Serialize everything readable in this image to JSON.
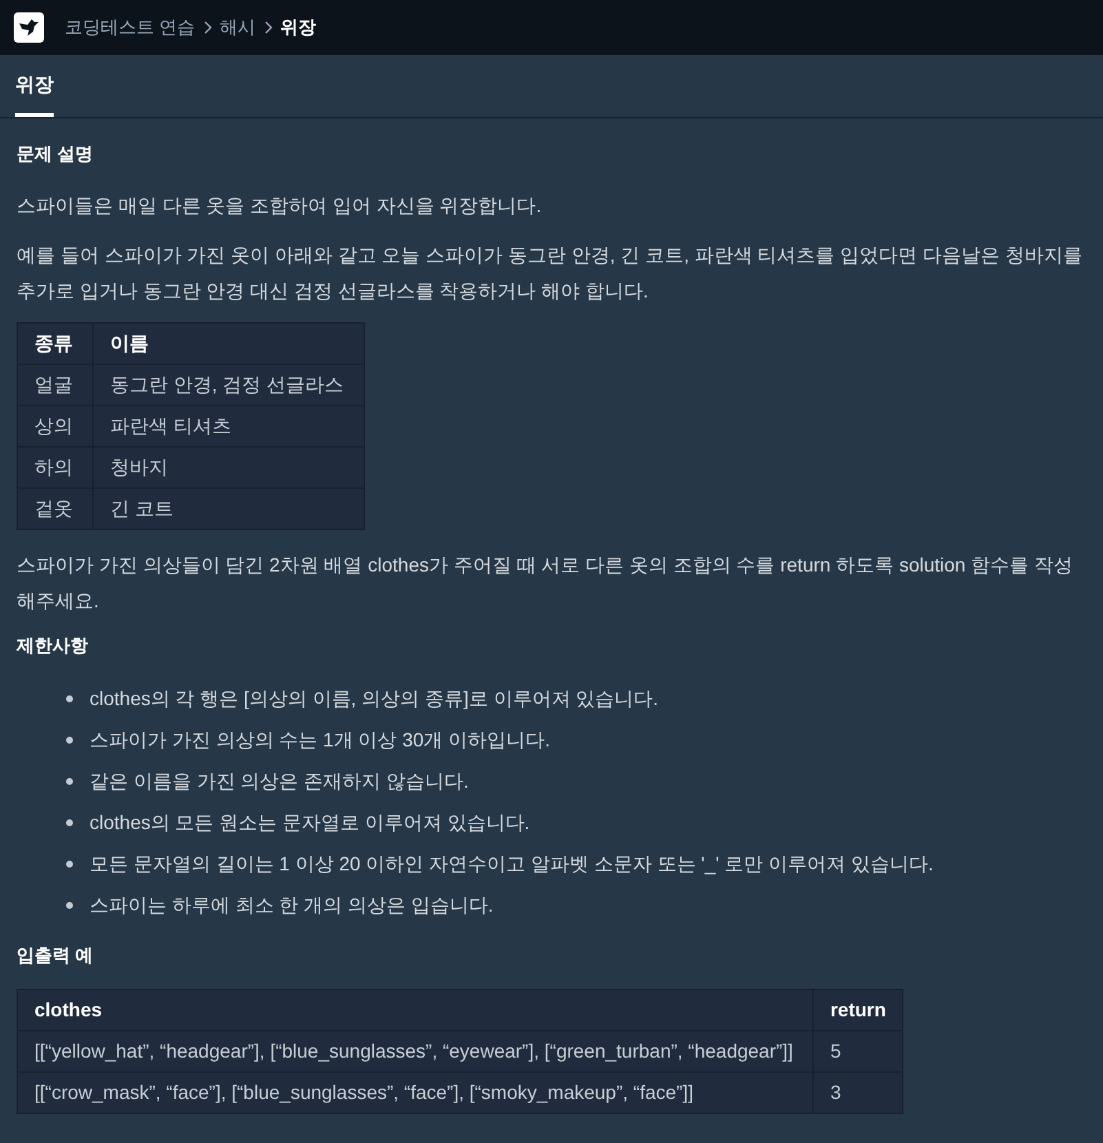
{
  "breadcrumb": [
    "코딩테스트 연습",
    "해시",
    "위장"
  ],
  "tabs": [
    {
      "label": "위장",
      "selected": true
    }
  ],
  "sections": [
    {
      "title": "문제 설명",
      "blocks": [
        {
          "kind": "paragraph",
          "text": "스파이들은 매일 다른 옷을 조합하여 입어 자신을 위장합니다."
        },
        {
          "kind": "paragraph",
          "text": "예를 들어 스파이가 가진 옷이 아래와 같고 오늘 스파이가 동그란 안경, 긴 코트, 파란색 티셔츠를 입었다면 다음날은 청바지를 추가로 입거나 동그란 안경 대신 검정 선글라스를 착용하거나 해야 합니다."
        },
        {
          "kind": "table",
          "columns": [
            "종류",
            "이름"
          ],
          "rows": [
            [
              "얼굴",
              "동그란 안경, 검정 선글라스"
            ],
            [
              "상의",
              "파란색 티셔츠"
            ],
            [
              "하의",
              "청바지"
            ],
            [
              "겉옷",
              "긴 코트"
            ]
          ]
        },
        {
          "kind": "paragraph",
          "text": "스파이가 가진 의상들이 담긴 2차원 배열 clothes가 주어질 때 서로 다른 옷의 조합의 수를 return 하도록 solution 함수를 작성해주세요."
        }
      ]
    },
    {
      "title": "제한사항",
      "blocks": [
        {
          "kind": "list",
          "items": [
            "clothes의 각 행은 [의상의 이름, 의상의 종류]로 이루어져 있습니다.",
            "스파이가 가진 의상의 수는 1개 이상 30개 이하입니다.",
            "같은 이름을 가진 의상은 존재하지 않습니다.",
            "clothes의 모든 원소는 문자열로 이루어져 있습니다.",
            "모든 문자열의 길이는 1 이상 20 이하인 자연수이고 알파벳 소문자 또는 '_' 로만 이루어져 있습니다.",
            "스파이는 하루에 최소 한 개의 의상은 입습니다."
          ]
        }
      ]
    },
    {
      "title": "입출력 예",
      "blocks": [
        {
          "kind": "table",
          "columns": [
            "clothes",
            "return"
          ],
          "rows": [
            [
              "[[“yellow_hat”, “headgear”], [“blue_sunglasses”, “eyewear”], [“green_turban”, “headgear”]]",
              "5"
            ],
            [
              "[[“crow_mask”, “face”], [“blue_sunglasses”, “face”], [“smoky_makeup”, “face”]]",
              "3"
            ]
          ]
        }
      ]
    }
  ]
}
